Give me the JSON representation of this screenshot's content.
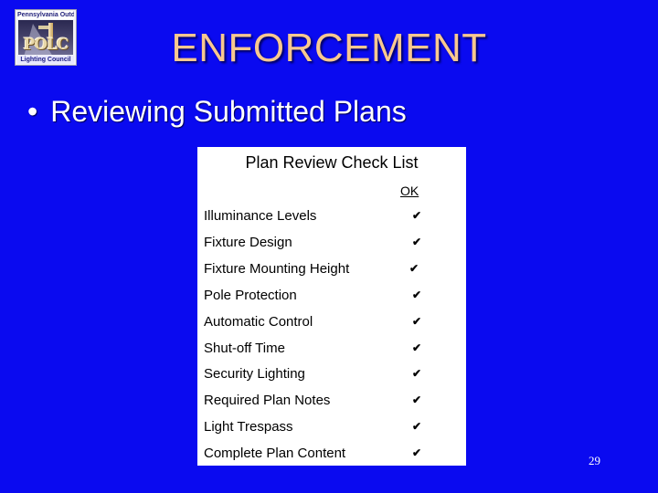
{
  "logo": {
    "top_text": "Pennsylvania Outdoor",
    "main_text": "POLC",
    "bottom_text": "Lighting Council"
  },
  "slide": {
    "title": "ENFORCEMENT",
    "bullet_symbol": "•",
    "bullet_text": "Reviewing Submitted Plans",
    "page_number": "29"
  },
  "checklist": {
    "title": "Plan Review Check List",
    "ok_header": "OK",
    "check_glyph": "✔",
    "items": [
      {
        "label": "Illuminance Levels",
        "ok": true
      },
      {
        "label": "Fixture Design",
        "ok": true
      },
      {
        "label": "Fixture Mounting Height",
        "ok": true
      },
      {
        "label": "Pole Protection",
        "ok": true
      },
      {
        "label": "Automatic Control",
        "ok": true
      },
      {
        "label": "Shut-off Time",
        "ok": true
      },
      {
        "label": "Security Lighting",
        "ok": true
      },
      {
        "label": "Required Plan Notes",
        "ok": true
      },
      {
        "label": "Light Trespass",
        "ok": true
      },
      {
        "label": "Complete Plan Content",
        "ok": true
      }
    ]
  },
  "colors": {
    "background": "#0a0af0",
    "title": "#f8c890",
    "bullet_text": "#ffffff",
    "card": "#ffffff"
  }
}
